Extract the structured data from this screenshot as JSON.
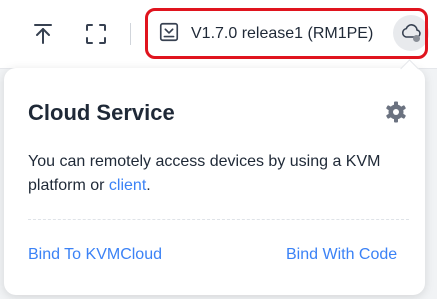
{
  "toolbar": {
    "upload_icon": "arrow-up-to-line-icon",
    "fullscreen_icon": "fullscreen-icon",
    "version_icon": "download-box-icon",
    "version_label": "V1.7.0 release1 (RM1PE)",
    "cloud_icon": "cloud-icon",
    "cloud_status": "offline"
  },
  "popover": {
    "title": "Cloud Service",
    "settings_icon": "gear-icon",
    "description_text": "You can remotely access devices by using a KVM platform or ",
    "description_link": "client",
    "description_end": ".",
    "bind_cloud_label": "Bind To KVMCloud",
    "bind_code_label": "Bind With Code"
  },
  "colors": {
    "highlight": "#e0141e",
    "link": "#3b82f6",
    "text": "#1f2937",
    "status_dot": "#8a8f97"
  }
}
